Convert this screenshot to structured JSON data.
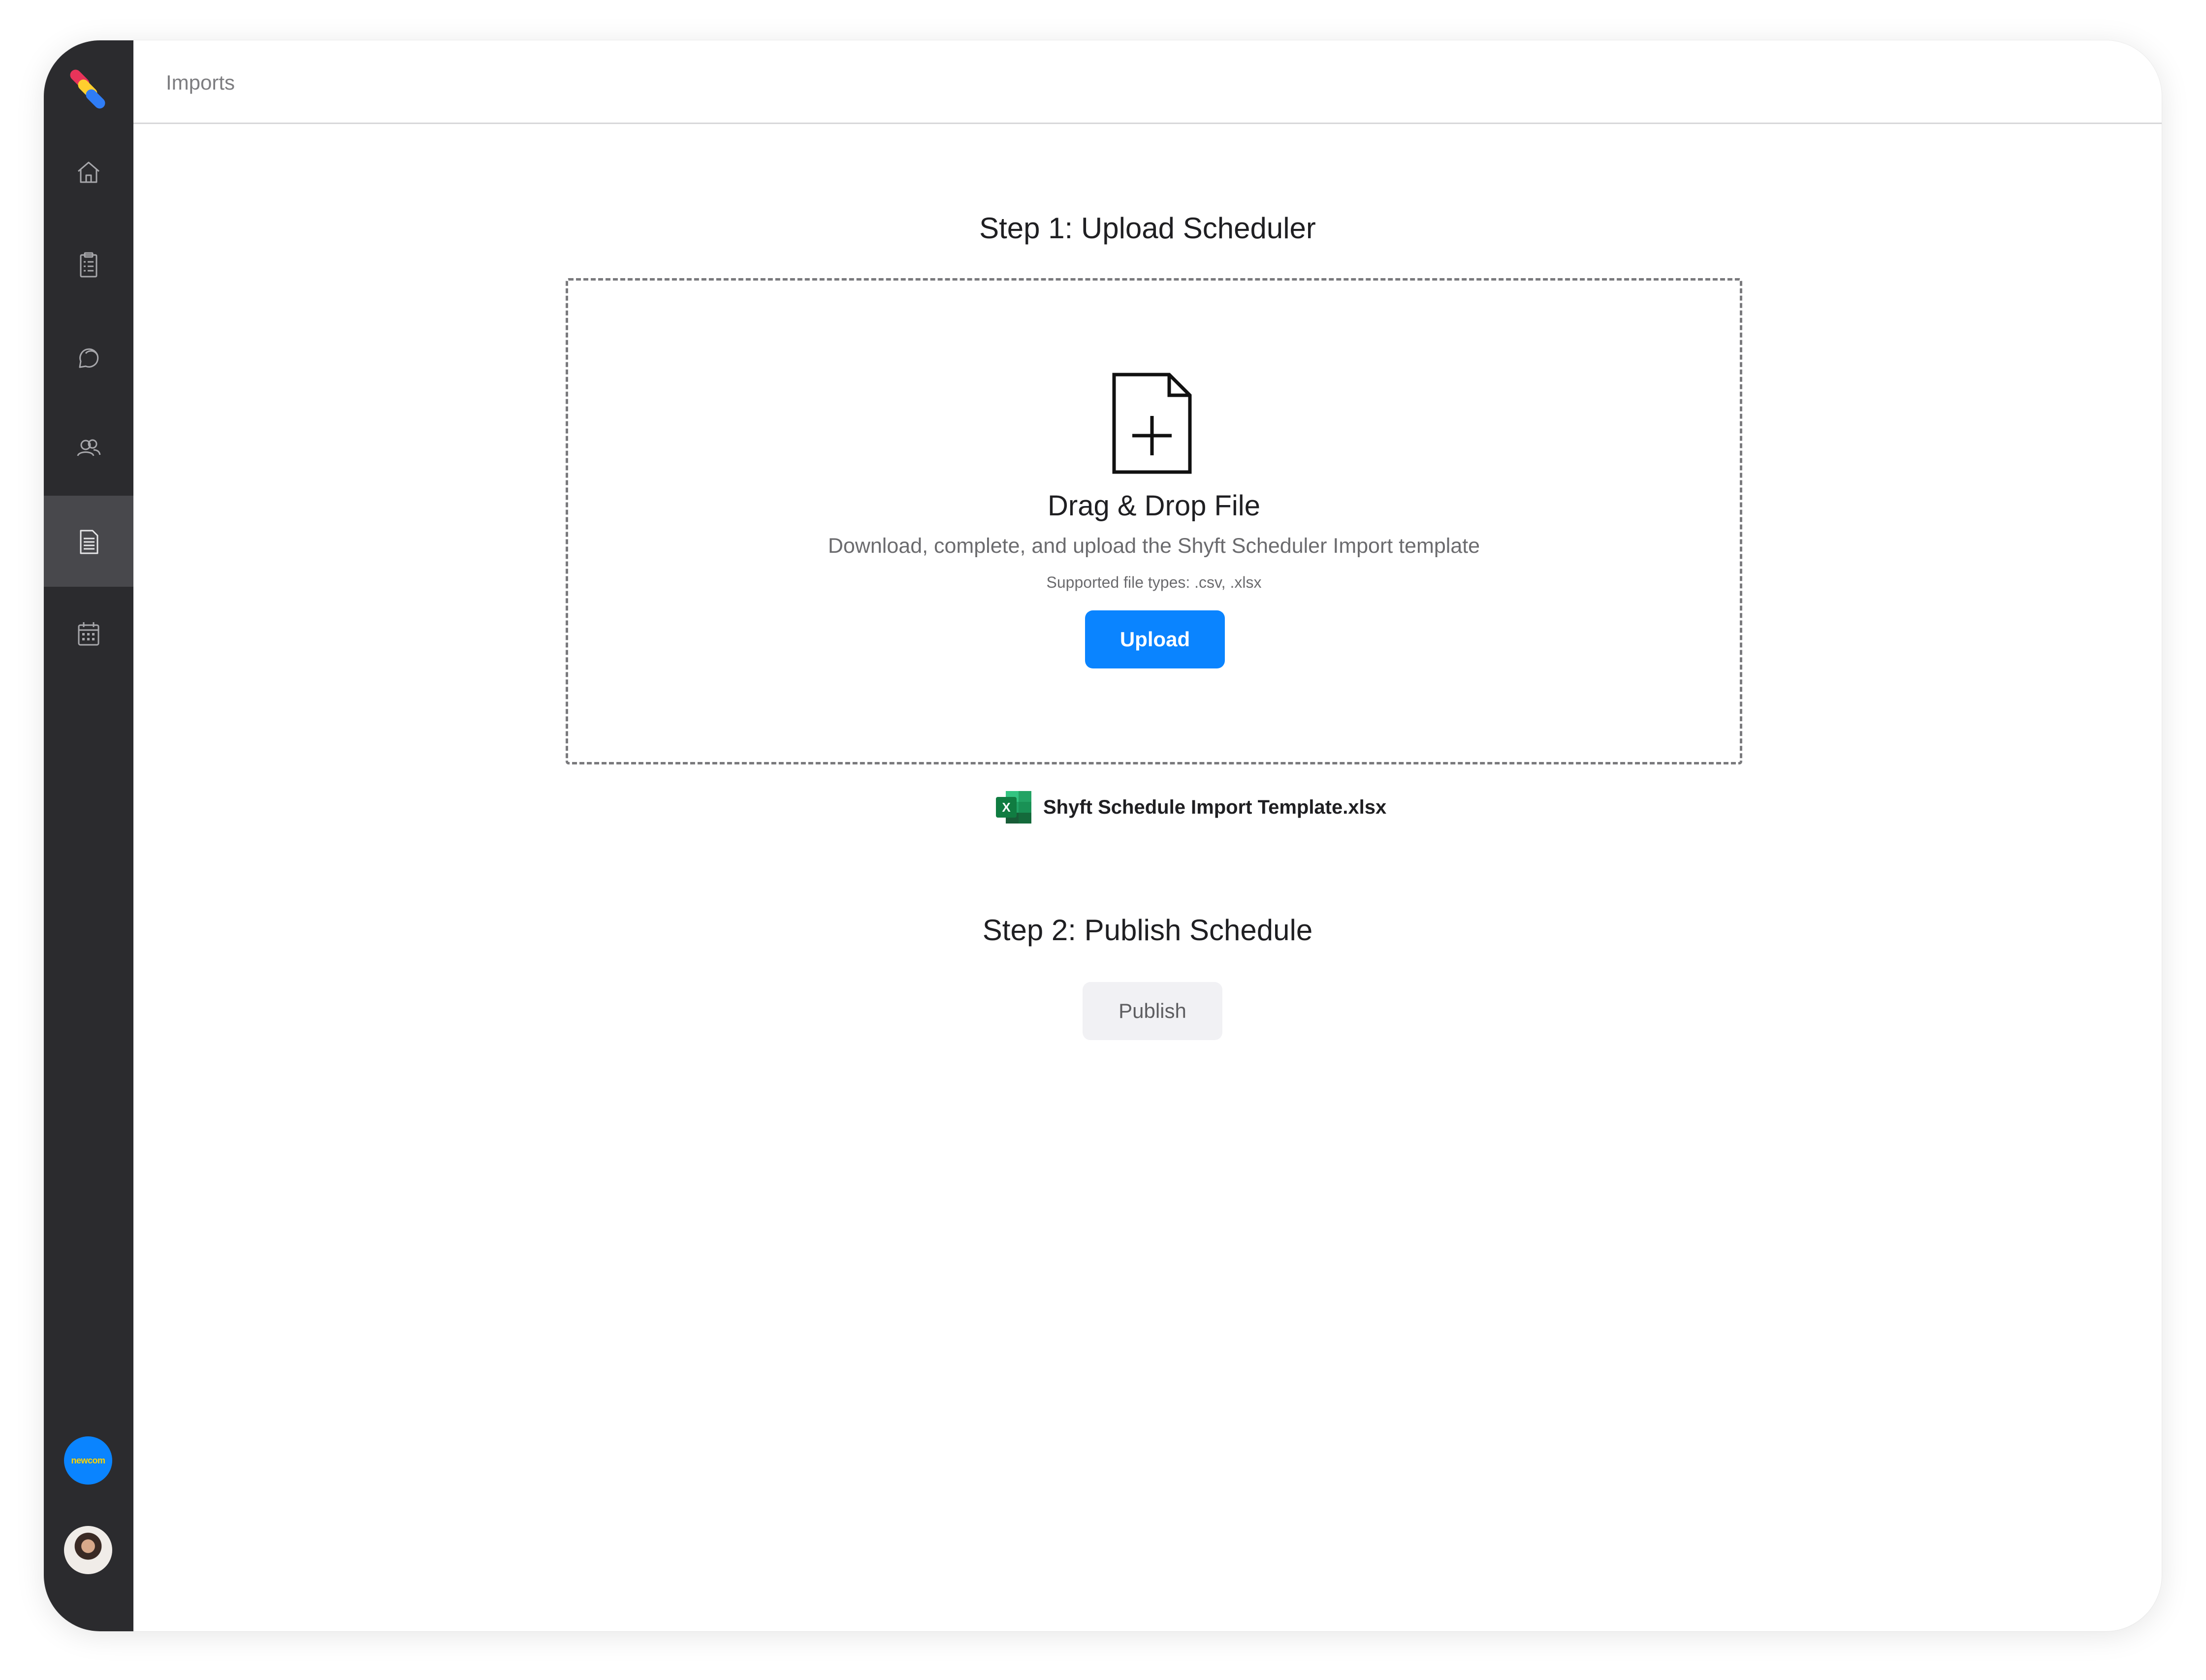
{
  "header": {
    "breadcrumb": "Imports"
  },
  "sidebar": {
    "items": [
      {
        "icon": "home-icon"
      },
      {
        "icon": "clipboard-icon"
      },
      {
        "icon": "chat-icon"
      },
      {
        "icon": "users-icon"
      },
      {
        "icon": "document-icon",
        "active": true
      },
      {
        "icon": "calendar-icon"
      }
    ],
    "org_badge": "newcom",
    "avatar": "user-avatar"
  },
  "step1": {
    "title": "Step 1: Upload Scheduler",
    "drop_title": "Drag & Drop File",
    "description": "Download, complete, and upload the Shyft Scheduler Import template",
    "supported_types": "Supported file types: .csv, .xlsx",
    "upload_label": "Upload",
    "template_file": "Shyft Schedule Import Template.xlsx"
  },
  "step2": {
    "title": "Step 2: Publish Schedule",
    "publish_label": "Publish"
  },
  "colors": {
    "accent": "#0a84ff",
    "sidebar": "#2b2b2e",
    "sidebar_active": "#48484c",
    "disabled_button": "#f1f1f4"
  }
}
